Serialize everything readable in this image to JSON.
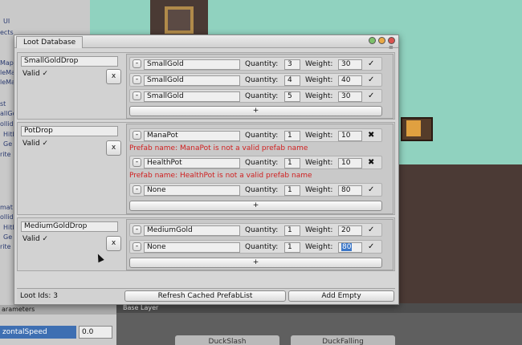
{
  "background": {
    "left_fragments": [
      "UI",
      "ects",
      "MapC",
      "leMa",
      "leMa",
      "st",
      "allGol",
      "ollid",
      "Ge",
      "Hitb",
      "rite",
      "mat",
      "ollid",
      "Hitb",
      "Ge",
      "rite"
    ],
    "parameters_label": "arameters",
    "speed_label": "zontalSpeed",
    "speed_value": "0.0",
    "base_layer": "Base Layer",
    "nodes": [
      "DuckSlash",
      "DuckFalling"
    ]
  },
  "window": {
    "title": "Loot Database"
  },
  "drops": [
    {
      "name": "SmallGoldDrop",
      "valid": "Valid ✓",
      "remove": "x",
      "items": [
        {
          "prefab": "SmallGold",
          "quantity": "3",
          "weight": "30",
          "mark": "✓"
        },
        {
          "prefab": "SmallGold",
          "quantity": "4",
          "weight": "40",
          "mark": "✓"
        },
        {
          "prefab": "SmallGold",
          "quantity": "5",
          "weight": "30",
          "mark": "✓"
        }
      ]
    },
    {
      "name": "PotDrop",
      "valid": "Valid ✓",
      "remove": "x",
      "items": [
        {
          "prefab": "ManaPot",
          "quantity": "1",
          "weight": "10",
          "mark": "✖",
          "error": "Prefab name: ManaPot is not a valid prefab name"
        },
        {
          "prefab": "HealthPot",
          "quantity": "1",
          "weight": "10",
          "mark": "✖",
          "error": "Prefab name: HealthPot is not a valid prefab name"
        },
        {
          "prefab": "None",
          "quantity": "1",
          "weight": "80",
          "mark": "✓"
        }
      ]
    },
    {
      "name": "MediumGoldDrop",
      "valid": "Valid ✓",
      "remove": "x",
      "items": [
        {
          "prefab": "MediumGold",
          "quantity": "1",
          "weight": "20",
          "mark": "✓"
        },
        {
          "prefab": "None",
          "quantity": "1",
          "weight": "80",
          "mark": "✓"
        }
      ]
    }
  ],
  "labels": {
    "quantity": "Quantity:",
    "weight": "Weight:",
    "minus": "-",
    "plus": "+"
  },
  "footer": {
    "loot_ids": "Loot Ids: 3",
    "refresh": "Refresh Cached PrefabList",
    "add_empty": "Add Empty"
  }
}
